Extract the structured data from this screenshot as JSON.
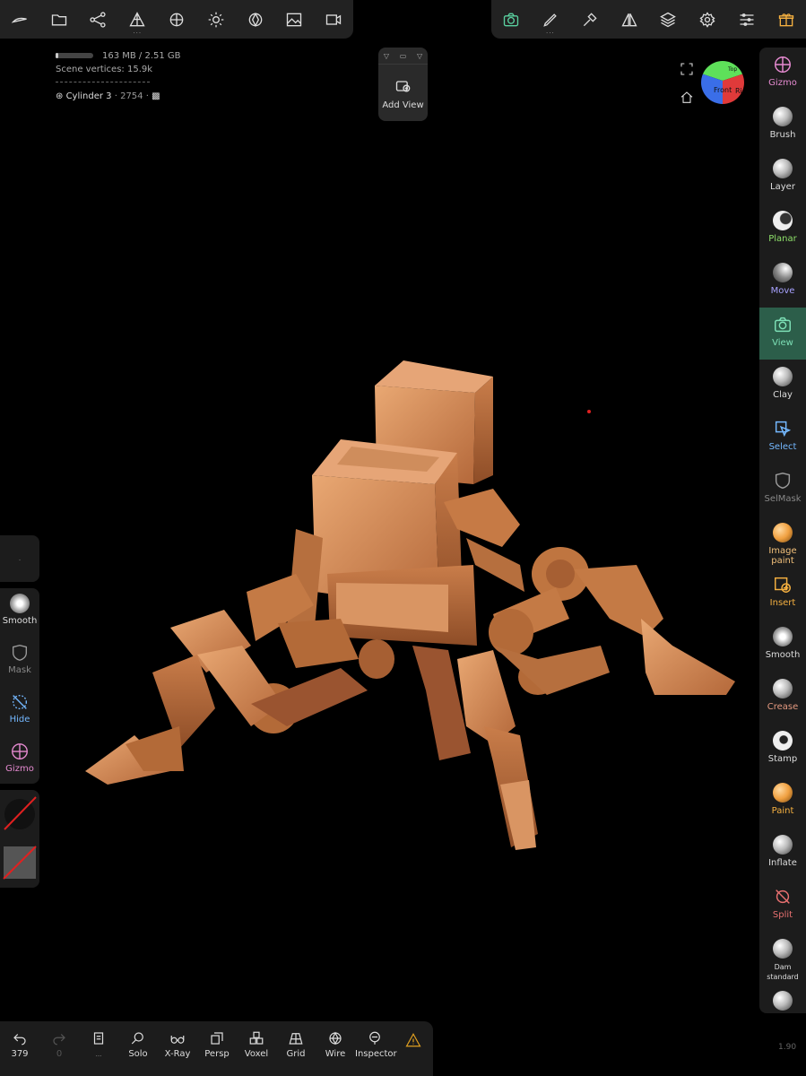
{
  "stats": {
    "memory": "163 MB / 2.51 GB",
    "memory_fraction": 0.065,
    "vertices_label": "Scene vertices",
    "vertices_value": "15.9k",
    "object_name": "Cylinder 3",
    "object_sub": "· 2754 ·"
  },
  "add_view": {
    "label": "Add View"
  },
  "cube": {
    "front": "Front",
    "right": "Ri",
    "top": "Top"
  },
  "top_toolbar_left": [
    "menu-icon",
    "folder-icon",
    "scene-graph-icon",
    "mesh-icon",
    "material-icon",
    "light-icon",
    "render-icon",
    "image-icon",
    "video-icon"
  ],
  "top_toolbar_right": [
    "camera-icon",
    "pen-icon",
    "picker-icon",
    "symmetry-icon",
    "layers-icon",
    "settings-icon",
    "sliders-icon",
    "gift-icon"
  ],
  "right_tools": [
    {
      "label": "Gizmo",
      "color": "#e58ad0"
    },
    {
      "label": "Brush",
      "color": "#dddddd"
    },
    {
      "label": "Layer",
      "color": "#dddddd"
    },
    {
      "label": "Planar",
      "color": "#8ee06a"
    },
    {
      "label": "Move",
      "color": "#a8a2ff"
    },
    {
      "label": "View",
      "color": "#7de0b6"
    },
    {
      "label": "Clay",
      "color": "#dddddd"
    },
    {
      "label": "Select",
      "color": "#74b8ff"
    },
    {
      "label": "SelMask",
      "color": "#888888"
    },
    {
      "label": "Image paint",
      "color": "#f2c07a"
    },
    {
      "label": "Insert",
      "color": "#f5b040"
    },
    {
      "label": "Smooth",
      "color": "#dddddd"
    },
    {
      "label": "Crease",
      "color": "#e59a80"
    },
    {
      "label": "Stamp",
      "color": "#dddddd"
    },
    {
      "label": "Paint",
      "color": "#f5b040"
    },
    {
      "label": "Inflate",
      "color": "#dddddd"
    },
    {
      "label": "Split",
      "color": "#e87070"
    },
    {
      "label": "Dam standard",
      "color": "#dddddd"
    }
  ],
  "left_tools": [
    {
      "label": "Smooth",
      "color": "#dddddd"
    },
    {
      "label": "Mask",
      "color": "#888888"
    },
    {
      "label": "Hide",
      "color": "#74b8ff"
    },
    {
      "label": "Gizmo",
      "color": "#e58ad0"
    }
  ],
  "left_top": {
    "label": "."
  },
  "bottom": {
    "undo_count": "379",
    "redo_count": "0",
    "items": [
      "Solo",
      "X-Ray",
      "Persp",
      "Voxel",
      "Grid",
      "Wire",
      "Inspector"
    ]
  },
  "version": "1.90"
}
